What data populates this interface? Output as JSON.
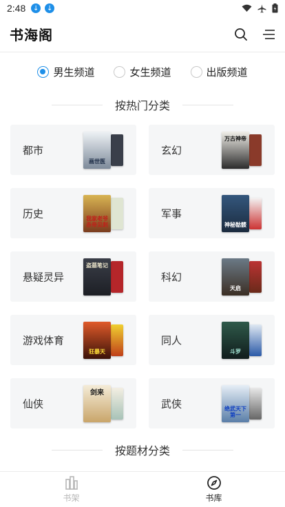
{
  "status": {
    "time": "2:48"
  },
  "header": {
    "title": "书海阁"
  },
  "channels": [
    {
      "label": "男生频道",
      "selected": true
    },
    {
      "label": "女生频道",
      "selected": false
    },
    {
      "label": "出版频道",
      "selected": false
    }
  ],
  "sections": {
    "by_popular": "按热门分类",
    "by_theme": "按题材分类"
  },
  "categories": [
    {
      "label": "都市",
      "cover_text": "画世医",
      "c1": "#e8edf1",
      "c2": "#5b6a7b"
    },
    {
      "label": "玄幻",
      "cover_text": "万古神帝",
      "c1": "#2b2b2b",
      "c2": "#7a5a3a"
    },
    {
      "label": "历史",
      "cover_text": "我家老爷赤帝见刺",
      "c1": "#c9a13b",
      "c2": "#a23b2a"
    },
    {
      "label": "军事",
      "cover_text": "神秘骷髅",
      "c1": "#2e4a6b",
      "c2": "#9c2b2b"
    },
    {
      "label": "悬疑灵异",
      "cover_text": "盗墓笔记",
      "c1": "#2c2f38",
      "c2": "#b12b2b"
    },
    {
      "label": "科幻",
      "cover_text": "天启",
      "c1": "#5a4a3a",
      "c2": "#3a3a3a"
    },
    {
      "label": "游戏体育",
      "cover_text": "狂暴天",
      "c1": "#b8352a",
      "c2": "#d88a2b"
    },
    {
      "label": "同人",
      "cover_text": "斗罗",
      "c1": "#1f3a3a",
      "c2": "#2b5aa8"
    },
    {
      "label": "仙侠",
      "cover_text": "剑来",
      "c1": "#e9dfc8",
      "c2": "#c9a56a"
    },
    {
      "label": "武侠",
      "cover_text": "绝武天下第一",
      "c1": "#d9e3ee",
      "c2": "#3b6ea8"
    }
  ],
  "tabs": [
    {
      "label": "书架",
      "active": false
    },
    {
      "label": "书库",
      "active": true
    }
  ],
  "colors": {
    "accent": "#1e8fe8"
  }
}
